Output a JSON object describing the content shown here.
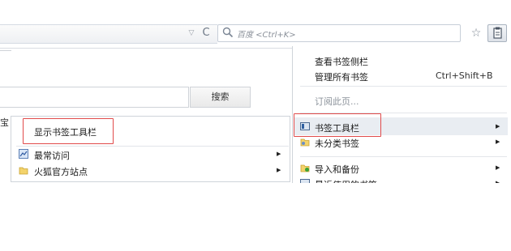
{
  "toolbar": {
    "search_placeholder": "百度 <Ctrl+K>",
    "dropdown_glyph": "▽",
    "reload_glyph": "C",
    "star_glyph": "☆"
  },
  "page": {
    "search_button": "搜索",
    "side_char": "宝"
  },
  "left_menu": {
    "items": [
      {
        "label": "显示书签工具栏",
        "icon": null,
        "submenu": false
      },
      {
        "label": "最常访问",
        "icon": "frequent-icon",
        "submenu": true
      },
      {
        "label": "火狐官方站点",
        "icon": "folder-icon",
        "submenu": true
      }
    ]
  },
  "bookmarks_menu": {
    "items": [
      {
        "label": "查看书签侧栏",
        "shortcut": ""
      },
      {
        "label": "管理所有书签",
        "shortcut": "Ctrl+Shift+B"
      },
      {
        "label": "订阅此页...",
        "disabled": true
      },
      {
        "label": "书签工具栏",
        "icon": "bookmarks-toolbar-icon",
        "submenu": true
      },
      {
        "label": "未分类书签",
        "icon": "unsorted-bookmarks-icon",
        "submenu": true
      },
      {
        "label": "导入和备份",
        "icon": "import-backup-icon",
        "submenu": true
      },
      {
        "label": "最近使用的书签",
        "icon": "recent-bookmarks-icon",
        "submenu": true
      }
    ]
  },
  "colors": {
    "highlight_box": "#e14b4b",
    "menu_border": "#cfd4da",
    "hover_row": "#e9edf2"
  }
}
